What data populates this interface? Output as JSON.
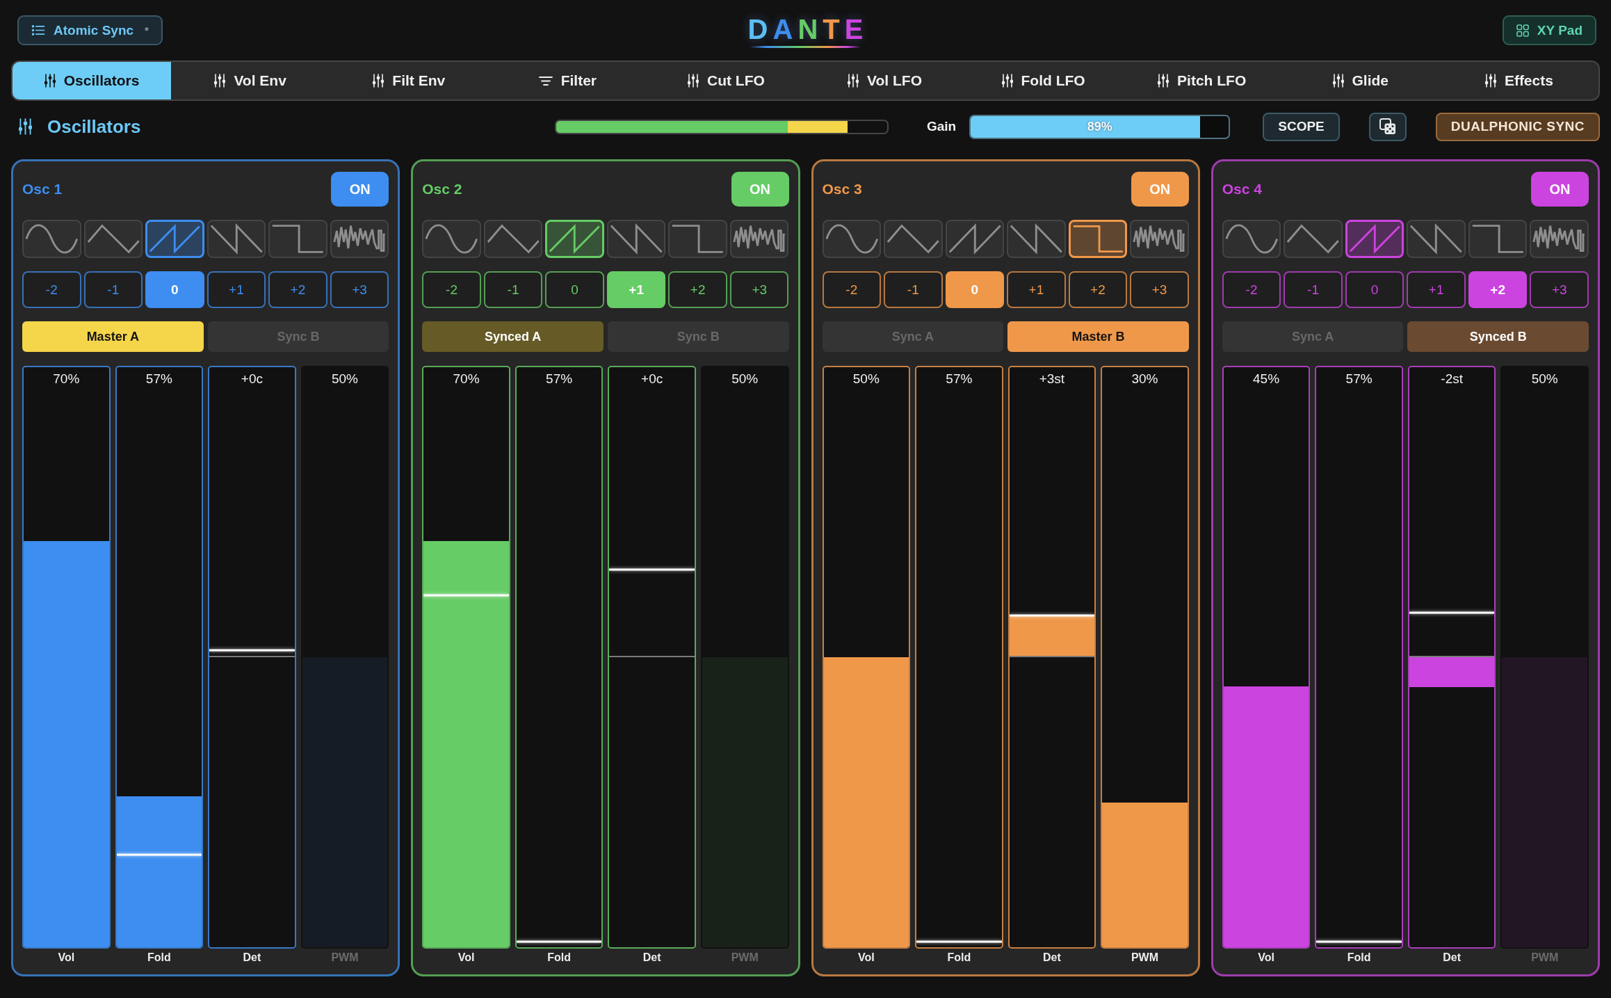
{
  "header": {
    "preset": {
      "name": "Atomic Sync",
      "modified_mark": "*"
    },
    "logo": "DANTE",
    "xy_pad_button": "XY Pad"
  },
  "tabs": [
    {
      "label": "Oscillators",
      "kind": "module",
      "selected": true
    },
    {
      "label": "Vol Env",
      "kind": "module",
      "selected": false
    },
    {
      "label": "Filt Env",
      "kind": "module",
      "selected": false
    },
    {
      "label": "Filter",
      "kind": "filter",
      "selected": false
    },
    {
      "label": "Cut LFO",
      "kind": "module",
      "selected": false
    },
    {
      "label": "Vol LFO",
      "kind": "module",
      "selected": false
    },
    {
      "label": "Fold LFO",
      "kind": "module",
      "selected": false
    },
    {
      "label": "Pitch LFO",
      "kind": "module",
      "selected": false
    },
    {
      "label": "Glide",
      "kind": "module",
      "selected": false
    },
    {
      "label": "Effects",
      "kind": "module",
      "selected": false
    }
  ],
  "section": {
    "title": "Oscillators",
    "meter": {
      "level": 0.88
    },
    "gain": {
      "label": "Gain",
      "level": 0.89,
      "reading": "89%"
    },
    "scope_button": "SCOPE",
    "dualphonic_button": "DUALPHONIC SYNC"
  },
  "oscillators": [
    {
      "name": "Osc 1",
      "color": "#3d8ef0",
      "power": {
        "label": "ON",
        "on": true
      },
      "waveforms": [
        {
          "kind": "sine",
          "selected": false
        },
        {
          "kind": "triangle",
          "selected": false
        },
        {
          "kind": "saw_up",
          "selected": true
        },
        {
          "kind": "saw_down",
          "selected": false
        },
        {
          "kind": "square",
          "selected": false
        },
        {
          "kind": "noise",
          "selected": false
        }
      ],
      "octaves": [
        {
          "label": "-2",
          "selected": false
        },
        {
          "label": "-1",
          "selected": false
        },
        {
          "label": "0",
          "selected": true
        },
        {
          "label": "+1",
          "selected": false
        },
        {
          "label": "+2",
          "selected": false
        },
        {
          "label": "+3",
          "selected": false
        }
      ],
      "sync": [
        {
          "label": "Master A",
          "kind": "master"
        },
        {
          "label": "Sync B",
          "kind": "off"
        }
      ],
      "sliders": [
        {
          "label": "Vol",
          "reading": "70%",
          "kind": "unipolar",
          "enabled": true,
          "level": 0.7
        },
        {
          "label": "Fold",
          "reading": "57%",
          "kind": "unipolar",
          "enabled": true,
          "level": 0.26,
          "modulation": {
            "level": 0.16
          }
        },
        {
          "label": "Det",
          "reading": "+0c",
          "kind": "bipolar",
          "enabled": true,
          "level": 0.5,
          "modulation": {
            "level": 0.512
          }
        },
        {
          "label": "PWM",
          "reading": "50%",
          "kind": "unipolar",
          "enabled": false,
          "level": 0.5
        }
      ]
    },
    {
      "name": "Osc 2",
      "color": "#66cc66",
      "power": {
        "label": "ON",
        "on": true
      },
      "waveforms": [
        {
          "kind": "sine",
          "selected": false
        },
        {
          "kind": "triangle",
          "selected": false
        },
        {
          "kind": "saw_up",
          "selected": true
        },
        {
          "kind": "saw_down",
          "selected": false
        },
        {
          "kind": "square",
          "selected": false
        },
        {
          "kind": "noise",
          "selected": false
        }
      ],
      "octaves": [
        {
          "label": "-2",
          "selected": false
        },
        {
          "label": "-1",
          "selected": false
        },
        {
          "label": "0",
          "selected": false
        },
        {
          "label": "+1",
          "selected": true
        },
        {
          "label": "+2",
          "selected": false
        },
        {
          "label": "+3",
          "selected": false
        }
      ],
      "sync": [
        {
          "label": "Synced A",
          "kind": "synced"
        },
        {
          "label": "Sync B",
          "kind": "off"
        }
      ],
      "sliders": [
        {
          "label": "Vol",
          "reading": "70%",
          "kind": "unipolar",
          "enabled": true,
          "level": 0.7,
          "modulation": {
            "level": 0.607
          }
        },
        {
          "label": "Fold",
          "reading": "57%",
          "kind": "unipolar",
          "enabled": true,
          "level": 0,
          "modulation": {
            "level": 0.01
          }
        },
        {
          "label": "Det",
          "reading": "+0c",
          "kind": "bipolar",
          "enabled": true,
          "level": 0.5,
          "modulation": {
            "level": 0.651
          }
        },
        {
          "label": "PWM",
          "reading": "50%",
          "kind": "unipolar",
          "enabled": false,
          "level": 0.5
        }
      ]
    },
    {
      "name": "Osc 3",
      "color": "#f0984a",
      "power": {
        "label": "ON",
        "on": true
      },
      "waveforms": [
        {
          "kind": "sine",
          "selected": false
        },
        {
          "kind": "triangle",
          "selected": false
        },
        {
          "kind": "saw_up",
          "selected": false
        },
        {
          "kind": "saw_down",
          "selected": false
        },
        {
          "kind": "square",
          "selected": true
        },
        {
          "kind": "noise",
          "selected": false
        }
      ],
      "octaves": [
        {
          "label": "-2",
          "selected": false
        },
        {
          "label": "-1",
          "selected": false
        },
        {
          "label": "0",
          "selected": true
        },
        {
          "label": "+1",
          "selected": false
        },
        {
          "label": "+2",
          "selected": false
        },
        {
          "label": "+3",
          "selected": false
        }
      ],
      "sync": [
        {
          "label": "Sync A",
          "kind": "off"
        },
        {
          "label": "Master B",
          "kind": "master"
        }
      ],
      "sliders": [
        {
          "label": "Vol",
          "reading": "50%",
          "kind": "unipolar",
          "enabled": true,
          "level": 0.5
        },
        {
          "label": "Fold",
          "reading": "57%",
          "kind": "unipolar",
          "enabled": true,
          "level": 0,
          "modulation": {
            "level": 0.01
          }
        },
        {
          "label": "Det",
          "reading": "+3st",
          "kind": "bipolar",
          "enabled": true,
          "level": 0.572,
          "modulation": {
            "level": 0.572
          }
        },
        {
          "label": "PWM",
          "reading": "30%",
          "kind": "unipolar",
          "enabled": true,
          "level": 0.25
        }
      ]
    },
    {
      "name": "Osc 4",
      "color": "#cc44e0",
      "power": {
        "label": "ON",
        "on": true
      },
      "waveforms": [
        {
          "kind": "sine",
          "selected": false
        },
        {
          "kind": "triangle",
          "selected": false
        },
        {
          "kind": "saw_up",
          "selected": true
        },
        {
          "kind": "saw_down",
          "selected": false
        },
        {
          "kind": "square",
          "selected": false
        },
        {
          "kind": "noise",
          "selected": false
        }
      ],
      "octaves": [
        {
          "label": "-2",
          "selected": false
        },
        {
          "label": "-1",
          "selected": false
        },
        {
          "label": "0",
          "selected": false
        },
        {
          "label": "+1",
          "selected": false
        },
        {
          "label": "+2",
          "selected": true
        },
        {
          "label": "+3",
          "selected": false
        }
      ],
      "sync": [
        {
          "label": "Sync A",
          "kind": "off"
        },
        {
          "label": "Synced B",
          "kind": "synced"
        }
      ],
      "sliders": [
        {
          "label": "Vol",
          "reading": "45%",
          "kind": "unipolar",
          "enabled": true,
          "level": 0.45
        },
        {
          "label": "Fold",
          "reading": "57%",
          "kind": "unipolar",
          "enabled": true,
          "level": 0,
          "modulation": {
            "level": 0.01
          }
        },
        {
          "label": "Det",
          "reading": "-2st",
          "kind": "bipolar",
          "enabled": true,
          "level": 0.449,
          "modulation": {
            "level": 0.577
          }
        },
        {
          "label": "PWM",
          "reading": "50%",
          "kind": "unipolar",
          "enabled": false,
          "level": 0.5
        }
      ]
    }
  ]
}
